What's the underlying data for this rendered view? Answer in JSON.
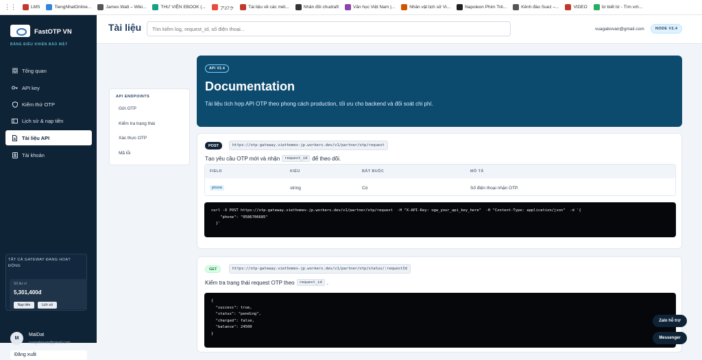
{
  "bookmarks": [
    {
      "label": "LMS",
      "color": "#c0392b"
    },
    {
      "label": "TiengNhatOnline...",
      "color": "#2e86de"
    },
    {
      "label": "James Watt – Wiki...",
      "color": "#555555"
    },
    {
      "label": "THƯ VIỆN EBOOK (...",
      "color": "#16a085"
    },
    {
      "label": "ア27ク",
      "color": "#e74c3c"
    },
    {
      "label": "Tài liệu về các mét...",
      "color": "#c0392b"
    },
    {
      "label": "Nhân đôi chudraft",
      "color": "#333333"
    },
    {
      "label": "Văn học Việt Nam |...",
      "color": "#8e44ad"
    },
    {
      "label": "Nhân vật lịch sử Vi...",
      "color": "#d35400"
    },
    {
      "label": "Napoleon Phim Trẻ...",
      "color": "#222222"
    },
    {
      "label": "Kênh đào Suez –...",
      "color": "#555555"
    },
    {
      "label": "VIDEO",
      "color": "#c0392b"
    },
    {
      "label": "từ biết từ - Tìm với...",
      "color": "#27ae60"
    }
  ],
  "sidebar": {
    "brand": "FastOTP VN",
    "subtitle": "BẢNG ĐIỀU KHIỂN BẢO MẬT",
    "items": [
      {
        "label": "Tổng quan",
        "icon": "grid-icon"
      },
      {
        "label": "API key",
        "icon": "key-icon"
      },
      {
        "label": "Kiểm thử OTP",
        "icon": "shield-icon"
      },
      {
        "label": "Lịch sử & nạp tiền",
        "icon": "wallet-icon"
      },
      {
        "label": "Tài liệu API",
        "icon": "document-icon",
        "active": true
      },
      {
        "label": "Tài khoản",
        "icon": "user-icon"
      }
    ],
    "gateway_status": "TẤT CẢ GATEWAY ĐANG HOẠT ĐỘNG",
    "balance_label": "Số dư ví",
    "balance_value": "5,301,400đ",
    "topup_label": "Nạp tiền",
    "history_label": "Lịch sử",
    "user": {
      "initial": "M",
      "name": "MaiDat",
      "email": "vuagabovan@gmail.com"
    },
    "logout_label": "Đăng xuất"
  },
  "header": {
    "title": "Tài liệu",
    "search_placeholder": "Tìm kiếm log, request_id, số điện thoại...",
    "email": "vuagabovan@gmail.com",
    "node_badge": "NODE V2.4"
  },
  "toc": {
    "heading": "API ENDPOINTS",
    "items": [
      "Gửi OTP",
      "Kiểm tra trạng thái",
      "Xác thực OTP",
      "Mã lỗi"
    ]
  },
  "hero": {
    "version": "API V2.4",
    "title": "Documentation",
    "description": "Tài liệu tích hợp API OTP theo phong cách production, tối ưu cho backend và đối soát chi phí."
  },
  "endpoint_post": {
    "method": "POST",
    "url": "https://otp-gateway.viethomes-jp.workers.dev/v1/partner/otp/request",
    "desc_before": "Tạo yêu cầu OTP mới và nhận",
    "desc_code": "request_id",
    "desc_after": "để theo dõi.",
    "columns": [
      "FIELD",
      "KIỂU",
      "BẮT BUỘC",
      "MÔ TẢ"
    ],
    "row": [
      "phone",
      "string",
      "Có",
      "Số điện thoại nhận OTP."
    ],
    "code": "curl -X POST https://otp-gateway.viethomes-jp.workers.dev/v1/partner/otp/request  -H \"X-API-Key: ogw_your_api_key_here\"  -H \"Content-Type: application/json\"  -d '{\n    \"phone\": \"0586706685\"\n  }'"
  },
  "endpoint_get": {
    "method": "GET",
    "url": "https://otp-gateway.viethomes-jp.workers.dev/v1/partner/otp/status/:requestId",
    "desc_before": "Kiểm tra trạng thái request OTP theo",
    "desc_code": "request_id",
    "desc_after": ".",
    "code": "{\n  \"success\": true,\n  \"status\": \"pending\",\n  \"charged\": false,\n  \"balance\": 24500\n}"
  },
  "floating": {
    "zalo": "Zalo hỗ trợ",
    "messenger": "Messenger"
  }
}
